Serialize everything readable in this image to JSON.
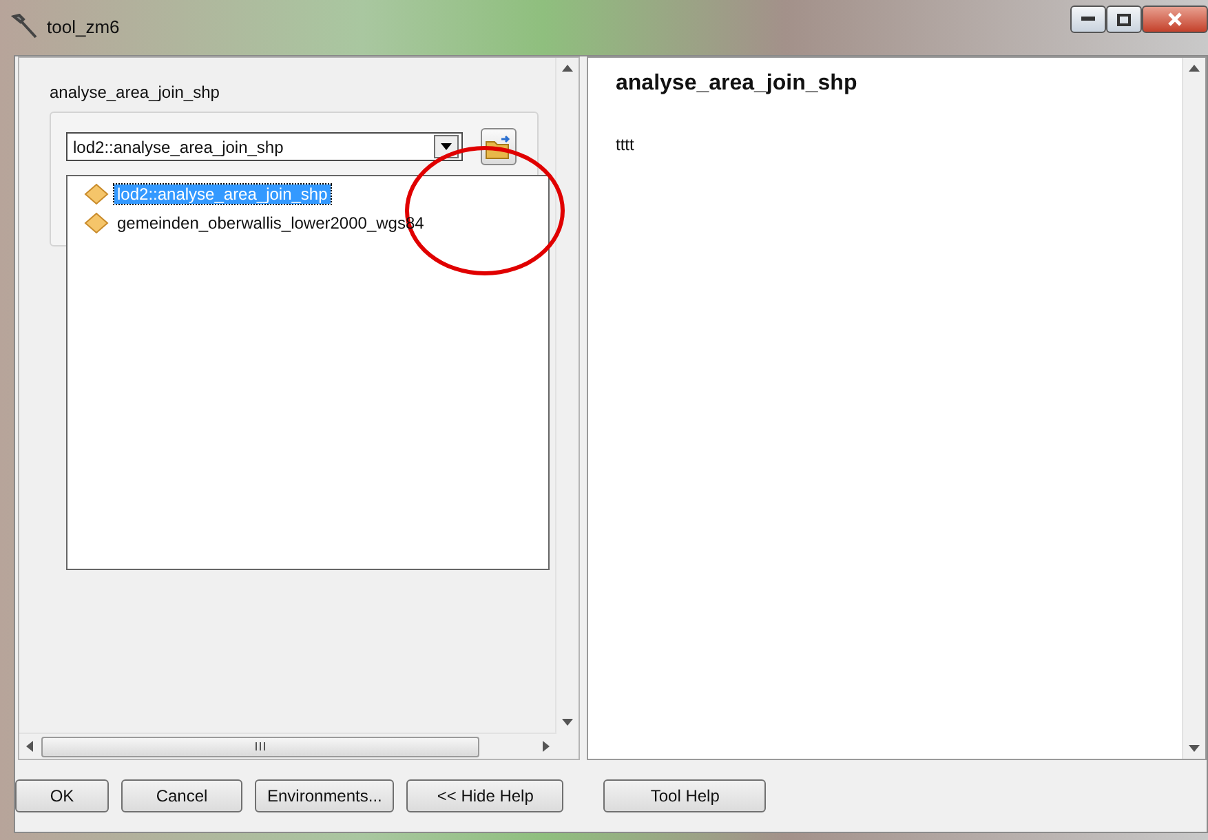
{
  "window": {
    "title": "tool_zm6"
  },
  "parameter": {
    "label": "analyse_area_join_shp",
    "value": "lod2::analyse_area_join_shp",
    "expanded": true,
    "options": [
      {
        "label": "lod2::analyse_area_join_shp",
        "selected": true
      },
      {
        "label": "gemeinden_oberwallis_lower2000_wgs84",
        "selected": false
      }
    ]
  },
  "help": {
    "title": "analyse_area_join_shp",
    "body": "tttt"
  },
  "buttons": [
    "OK",
    "Cancel",
    "Environments...",
    "<< Hide Help"
  ],
  "tool_help_button": "Tool Help"
}
